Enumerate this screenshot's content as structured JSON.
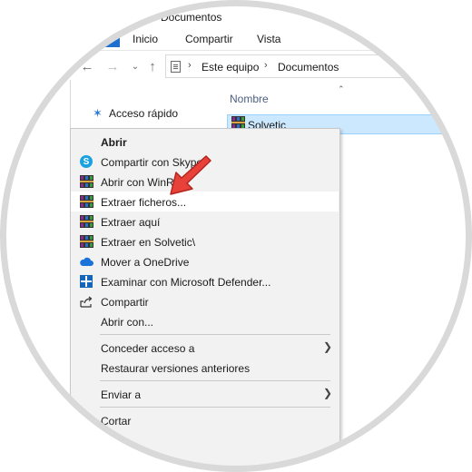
{
  "window": {
    "title": "Documentos"
  },
  "ribbon": {
    "tabs": [
      "Inicio",
      "Compartir",
      "Vista"
    ]
  },
  "nav": {
    "back_icon": "arrow-left-icon",
    "forward_icon": "arrow-right-icon",
    "recent_icon": "chevron-down-icon",
    "up_icon": "arrow-up-icon"
  },
  "address": {
    "crumbs": [
      "Este equipo",
      "Documentos"
    ]
  },
  "sidebar": {
    "quick_access": "Acceso rápido"
  },
  "file_list": {
    "column_name": "Nombre",
    "selected_file": "Solvetic"
  },
  "context_menu": {
    "items": [
      {
        "label": "Abrir",
        "icon": "none"
      },
      {
        "label": "Compartir con Skype",
        "icon": "skype-icon"
      },
      {
        "label": "Abrir con WinRAR",
        "icon": "winrar-icon"
      },
      {
        "label": "Extraer ficheros...",
        "icon": "winrar-icon"
      },
      {
        "label": "Extraer aquí",
        "icon": "winrar-icon"
      },
      {
        "label": "Extraer en Solvetic\\",
        "icon": "winrar-icon"
      },
      {
        "label": "Mover a OneDrive",
        "icon": "onedrive-icon"
      },
      {
        "label": "Examinar con Microsoft Defender...",
        "icon": "defender-icon"
      },
      {
        "label": "Compartir",
        "icon": "share-icon"
      },
      {
        "label": "Abrir con...",
        "icon": "none"
      },
      {
        "label": "Conceder acceso a",
        "icon": "none"
      },
      {
        "label": "Restaurar versiones anteriores",
        "icon": "none"
      },
      {
        "label": "Enviar a",
        "icon": "none"
      },
      {
        "label": "Cortar",
        "icon": "none"
      }
    ]
  },
  "colors": {
    "selection": "#cce8ff",
    "menu_bg": "#f2f2f2",
    "accent": "#1e6fd0",
    "pointer_arrow": "#e8413a"
  }
}
